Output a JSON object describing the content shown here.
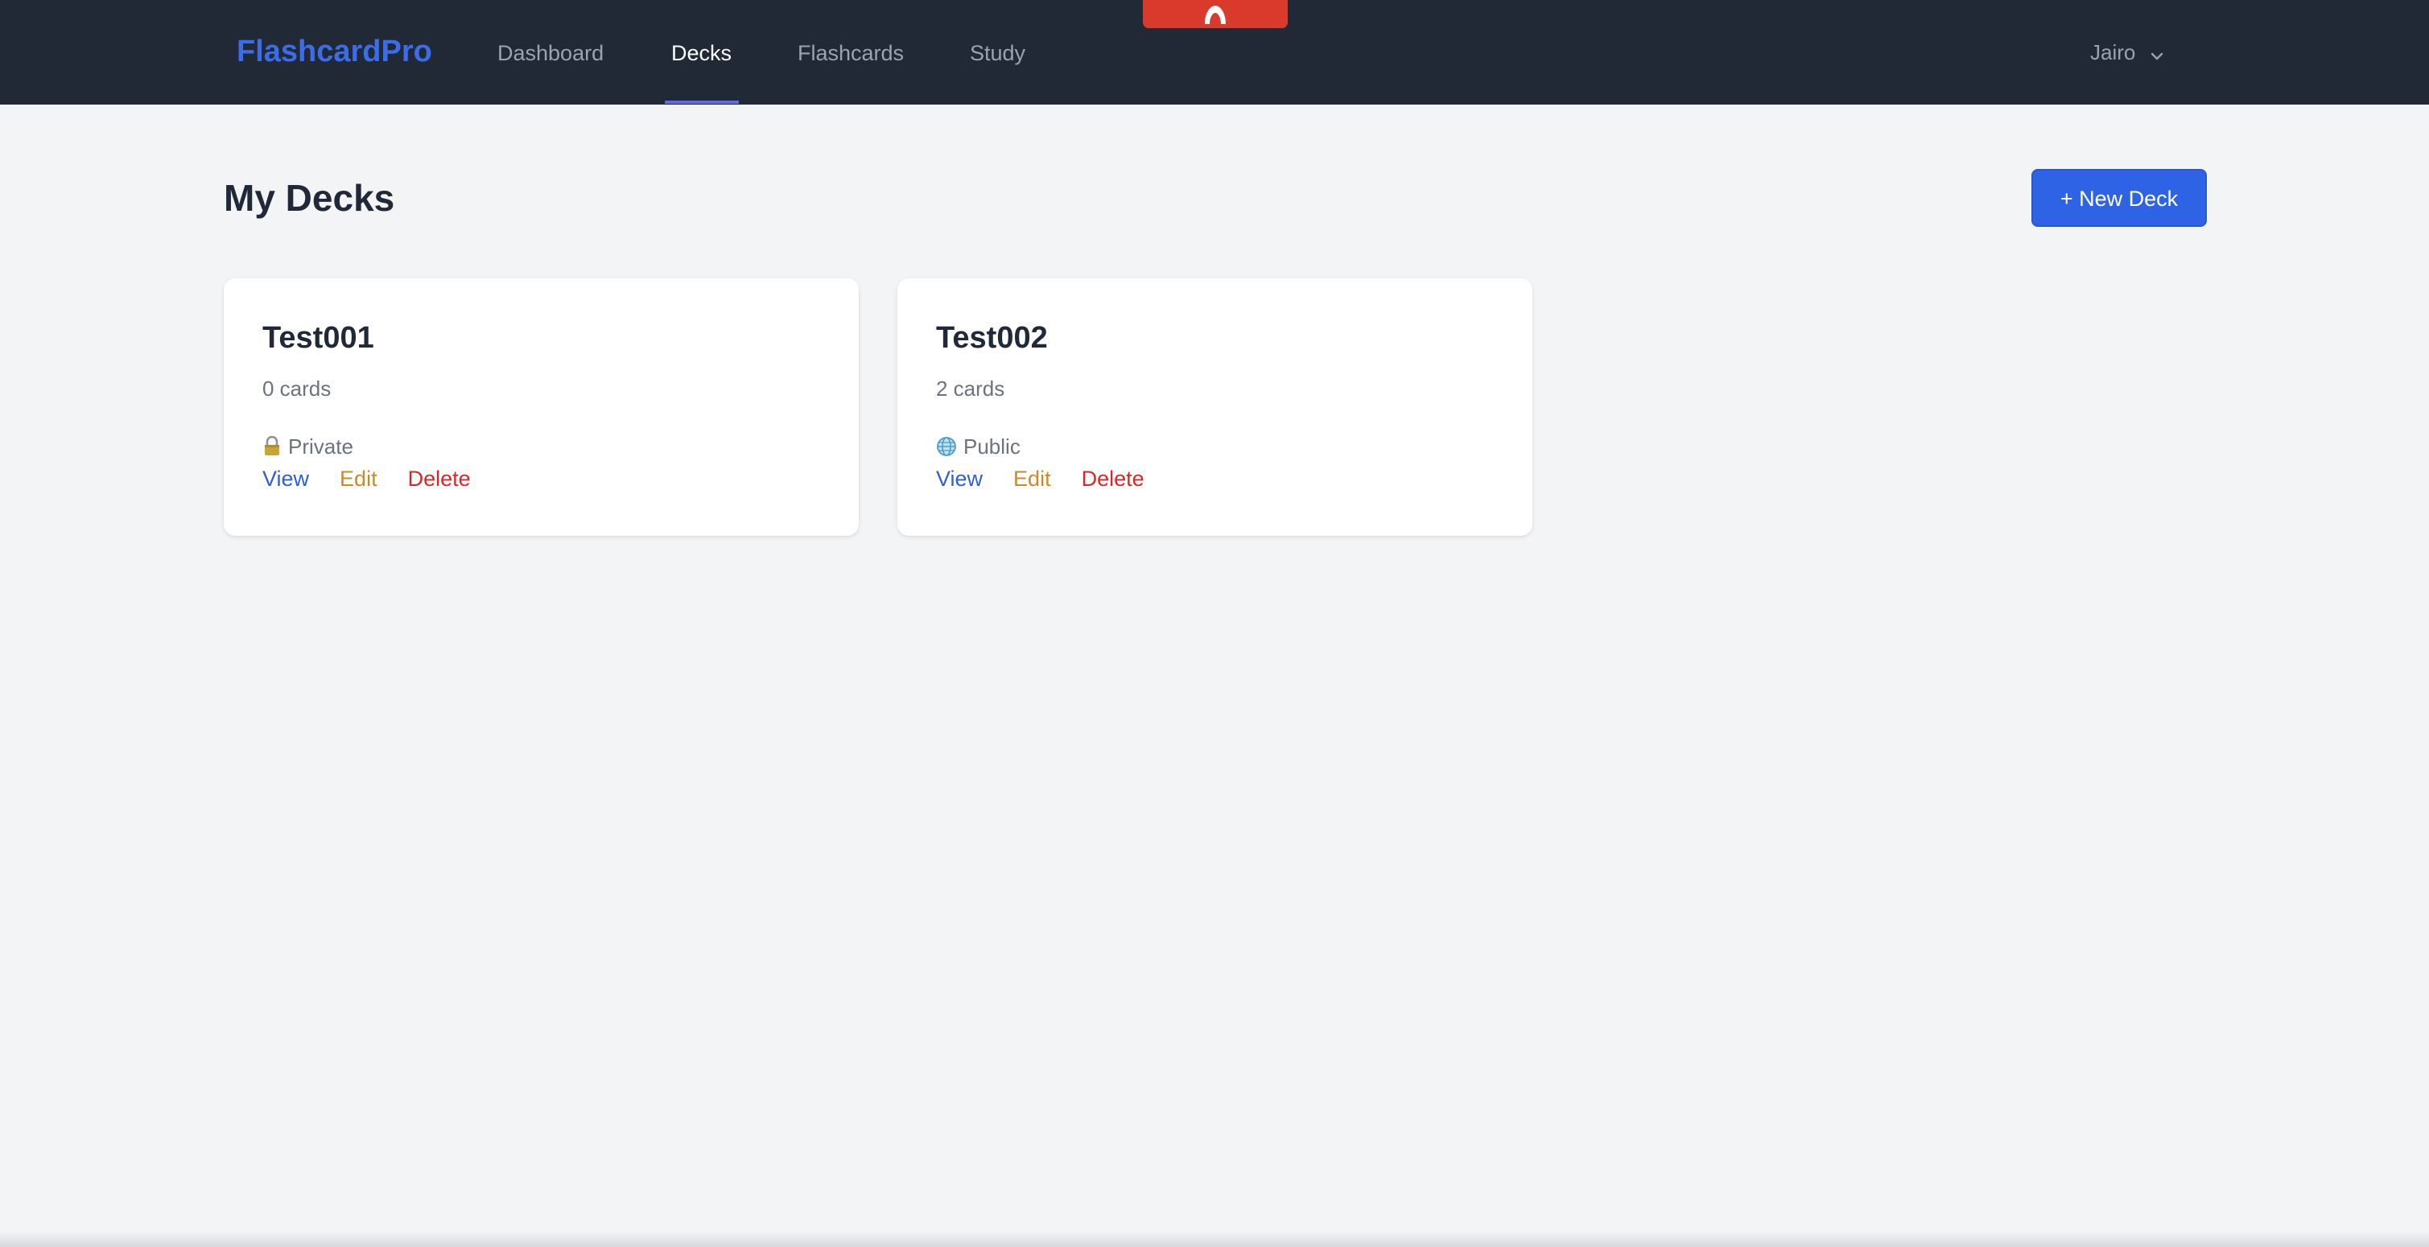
{
  "app": {
    "brand": "FlashcardPro",
    "accent_color": "#3b6ee6",
    "nav_bg": "#212836"
  },
  "nav": {
    "items": [
      {
        "label": "Dashboard",
        "active": false
      },
      {
        "label": "Decks",
        "active": true
      },
      {
        "label": "Flashcards",
        "active": false
      },
      {
        "label": "Study",
        "active": false
      }
    ],
    "center_tab_icon": "app-tab-icon",
    "user": {
      "name": "Jairo",
      "icon": "chevron-down-icon"
    }
  },
  "main": {
    "title": "My Decks",
    "new_deck_label": "+ New Deck",
    "decks": [
      {
        "name": "Test001",
        "count": "0 cards",
        "visibility": "Private",
        "visibility_icon": "lock-icon",
        "actions": {
          "view": "View",
          "edit": "Edit",
          "delete": "Delete"
        }
      },
      {
        "name": "Test002",
        "count": "2 cards",
        "visibility": "Public",
        "visibility_icon": "globe-icon",
        "actions": {
          "view": "View",
          "edit": "Edit",
          "delete": "Delete"
        }
      }
    ]
  },
  "colors": {
    "primary_button": "#2f63e6",
    "view_link": "#2f5fd8",
    "edit_link": "#ca8a2a",
    "delete_link": "#dc2626",
    "center_tab": "#d93a2b"
  }
}
